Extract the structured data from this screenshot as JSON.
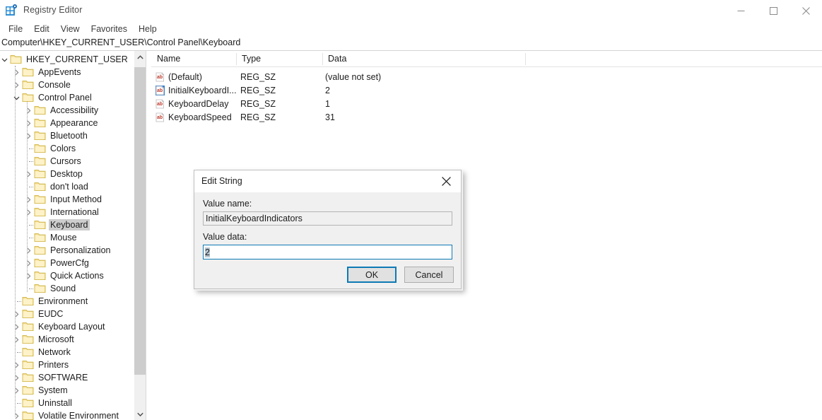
{
  "window": {
    "title": "Registry Editor",
    "icon": "registry-editor-icon",
    "controls": [
      {
        "name": "minimize-button",
        "glyph": "minimize-icon"
      },
      {
        "name": "maximize-button",
        "glyph": "maximize-icon"
      },
      {
        "name": "close-button",
        "glyph": "close-icon"
      }
    ]
  },
  "menubar": {
    "items": [
      {
        "label": "File"
      },
      {
        "label": "Edit"
      },
      {
        "label": "View"
      },
      {
        "label": "Favorites"
      },
      {
        "label": "Help"
      }
    ]
  },
  "address": {
    "path": "Computer\\HKEY_CURRENT_USER\\Control Panel\\Keyboard"
  },
  "tree": {
    "scrollbar": {
      "up_icon": "chevron-up-icon",
      "down_icon": "chevron-down-icon"
    },
    "nodes": [
      {
        "label": "HKEY_CURRENT_USER",
        "depth": 0,
        "state": "expanded",
        "selected": false
      },
      {
        "label": "AppEvents",
        "depth": 1,
        "state": "collapsed",
        "selected": false
      },
      {
        "label": "Console",
        "depth": 1,
        "state": "collapsed",
        "selected": false
      },
      {
        "label": "Control Panel",
        "depth": 1,
        "state": "expanded",
        "selected": false
      },
      {
        "label": "Accessibility",
        "depth": 2,
        "state": "collapsed",
        "selected": false
      },
      {
        "label": "Appearance",
        "depth": 2,
        "state": "collapsed",
        "selected": false
      },
      {
        "label": "Bluetooth",
        "depth": 2,
        "state": "collapsed",
        "selected": false
      },
      {
        "label": "Colors",
        "depth": 2,
        "state": "leaf",
        "selected": false
      },
      {
        "label": "Cursors",
        "depth": 2,
        "state": "leaf",
        "selected": false
      },
      {
        "label": "Desktop",
        "depth": 2,
        "state": "collapsed",
        "selected": false
      },
      {
        "label": "don't load",
        "depth": 2,
        "state": "leaf",
        "selected": false
      },
      {
        "label": "Input Method",
        "depth": 2,
        "state": "collapsed",
        "selected": false
      },
      {
        "label": "International",
        "depth": 2,
        "state": "collapsed",
        "selected": false
      },
      {
        "label": "Keyboard",
        "depth": 2,
        "state": "leaf",
        "selected": true
      },
      {
        "label": "Mouse",
        "depth": 2,
        "state": "leaf",
        "selected": false
      },
      {
        "label": "Personalization",
        "depth": 2,
        "state": "collapsed",
        "selected": false
      },
      {
        "label": "PowerCfg",
        "depth": 2,
        "state": "collapsed",
        "selected": false
      },
      {
        "label": "Quick Actions",
        "depth": 2,
        "state": "collapsed",
        "selected": false
      },
      {
        "label": "Sound",
        "depth": 2,
        "state": "leaf",
        "selected": false
      },
      {
        "label": "Environment",
        "depth": 1,
        "state": "leaf",
        "selected": false
      },
      {
        "label": "EUDC",
        "depth": 1,
        "state": "collapsed",
        "selected": false
      },
      {
        "label": "Keyboard Layout",
        "depth": 1,
        "state": "collapsed",
        "selected": false
      },
      {
        "label": "Microsoft",
        "depth": 1,
        "state": "collapsed",
        "selected": false
      },
      {
        "label": "Network",
        "depth": 1,
        "state": "leaf",
        "selected": false
      },
      {
        "label": "Printers",
        "depth": 1,
        "state": "collapsed",
        "selected": false
      },
      {
        "label": "SOFTWARE",
        "depth": 1,
        "state": "collapsed",
        "selected": false
      },
      {
        "label": "System",
        "depth": 1,
        "state": "collapsed",
        "selected": false
      },
      {
        "label": "Uninstall",
        "depth": 1,
        "state": "leaf",
        "selected": false
      },
      {
        "label": "Volatile Environment",
        "depth": 1,
        "state": "collapsed",
        "selected": false
      }
    ]
  },
  "list": {
    "columns": [
      {
        "label": "Name"
      },
      {
        "label": "Type"
      },
      {
        "label": "Data"
      }
    ],
    "rows": [
      {
        "name": "(Default)",
        "type": "REG_SZ",
        "data": "(value not set)",
        "icon": "string-value-icon",
        "selected": false
      },
      {
        "name": "InitialKeyboardI...",
        "type": "REG_SZ",
        "data": "2",
        "icon": "string-value-icon",
        "selected": true
      },
      {
        "name": "KeyboardDelay",
        "type": "REG_SZ",
        "data": "1",
        "icon": "string-value-icon",
        "selected": false
      },
      {
        "name": "KeyboardSpeed",
        "type": "REG_SZ",
        "data": "31",
        "icon": "string-value-icon",
        "selected": false
      }
    ]
  },
  "dialog": {
    "title": "Edit String",
    "close_icon": "close-icon",
    "value_name_label": "Value name:",
    "value_name": "InitialKeyboardIndicators",
    "value_data_label": "Value data:",
    "value_data": "2",
    "ok_label": "OK",
    "cancel_label": "Cancel"
  },
  "colors": {
    "accent": "#0d7ab5",
    "folder": "#fbe7a3",
    "selection_gray": "#cdcdcd",
    "icon_red": "#c0392b",
    "icon_blue": "#2d7dd2"
  }
}
